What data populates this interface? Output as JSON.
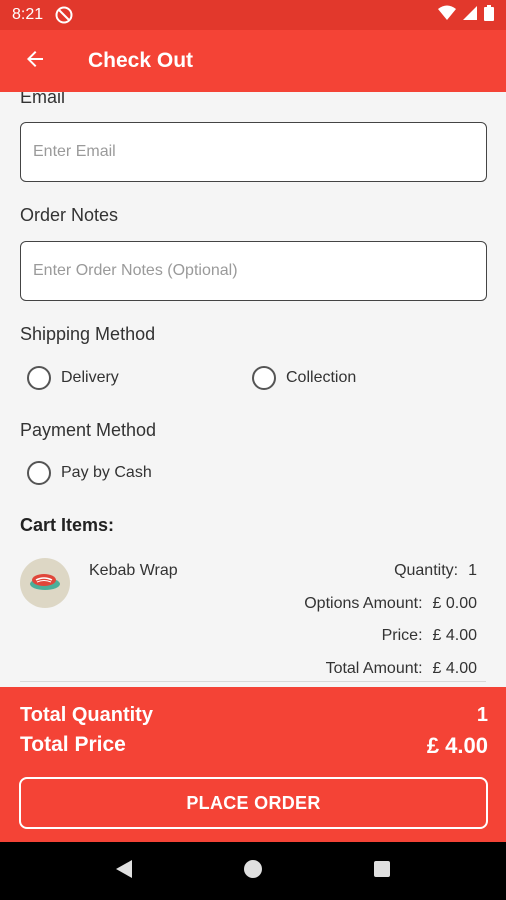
{
  "status_bar": {
    "time": "8:21"
  },
  "app_bar": {
    "title": "Check Out"
  },
  "form": {
    "email_label": "Email",
    "email_placeholder": "Enter Email",
    "notes_label": "Order Notes",
    "notes_placeholder": "Enter Order Notes (Optional)",
    "shipping_label": "Shipping Method",
    "shipping_options": [
      "Delivery",
      "Collection"
    ],
    "payment_label": "Payment Method",
    "payment_options": [
      "Pay by Cash"
    ]
  },
  "cart": {
    "title": "Cart Items:",
    "items": [
      {
        "name": "Kebab Wrap",
        "quantity_label": "Quantity:",
        "quantity": "1",
        "options_label": "Options Amount:",
        "options_amount": "£ 0.00",
        "price_label": "Price:",
        "price": "£ 4.00",
        "total_label": "Total Amount:",
        "total_amount": "£ 4.00"
      }
    ]
  },
  "summary": {
    "total_quantity_label": "Total Quantity",
    "total_quantity": "1",
    "total_price_label": "Total Price",
    "total_price": "£ 4.00",
    "place_order_label": "PLACE ORDER"
  },
  "colors": {
    "primary": "#f44336",
    "status_bar": "#e2382c",
    "nav_bar": "#000000"
  }
}
